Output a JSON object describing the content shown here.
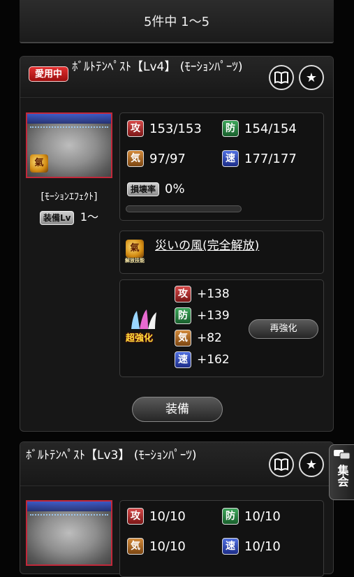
{
  "header": {
    "pagination": "5件中 1〜5"
  },
  "cards": [
    {
      "in_use_badge": "愛用中",
      "title": "ﾎﾞﾙﾄﾃﾝﾍﾟｽﾄ【Lv4】 (ﾓｰｼｮﾝﾊﾟｰﾂ)",
      "category": "[ﾓｰｼｮﾝｴﾌｪｸﾄ]",
      "equip_lv_label": "装備Lv",
      "equip_lv_value": "1〜",
      "stats": {
        "atk_label": "攻",
        "atk_value": "153/153",
        "def_label": "防",
        "def_value": "154/154",
        "qi_label": "気",
        "qi_value": "97/97",
        "spd_label": "速",
        "spd_value": "177/177"
      },
      "damage_label": "損壊率",
      "damage_value": "0%",
      "damage_progress": 0,
      "skill_name": "災いの風(完全解放)",
      "skill_emblem_text": "解放技能",
      "enhance_badge": "超強化",
      "bonus": {
        "atk_label": "攻",
        "atk_value": "+138",
        "def_label": "防",
        "def_value": "+139",
        "qi_label": "気",
        "qi_value": "+82",
        "spd_label": "速",
        "spd_value": "+162"
      },
      "reenhance_label": "再強化",
      "equip_button_label": "装備"
    },
    {
      "title": "ﾎﾞﾙﾄﾃﾝﾍﾟｽﾄ【Lv3】 (ﾓｰｼｮﾝﾊﾟｰﾂ)",
      "stats": {
        "atk_label": "攻",
        "atk_value": "10/10",
        "def_label": "防",
        "def_value": "10/10",
        "qi_label": "気",
        "qi_value": "10/10",
        "spd_label": "速",
        "spd_value": "10/10"
      }
    }
  ],
  "side_tab": {
    "label": "集会",
    "icon": "chat-bubbles-icon"
  },
  "icons": {
    "book": "book-icon",
    "star": "star-icon"
  }
}
